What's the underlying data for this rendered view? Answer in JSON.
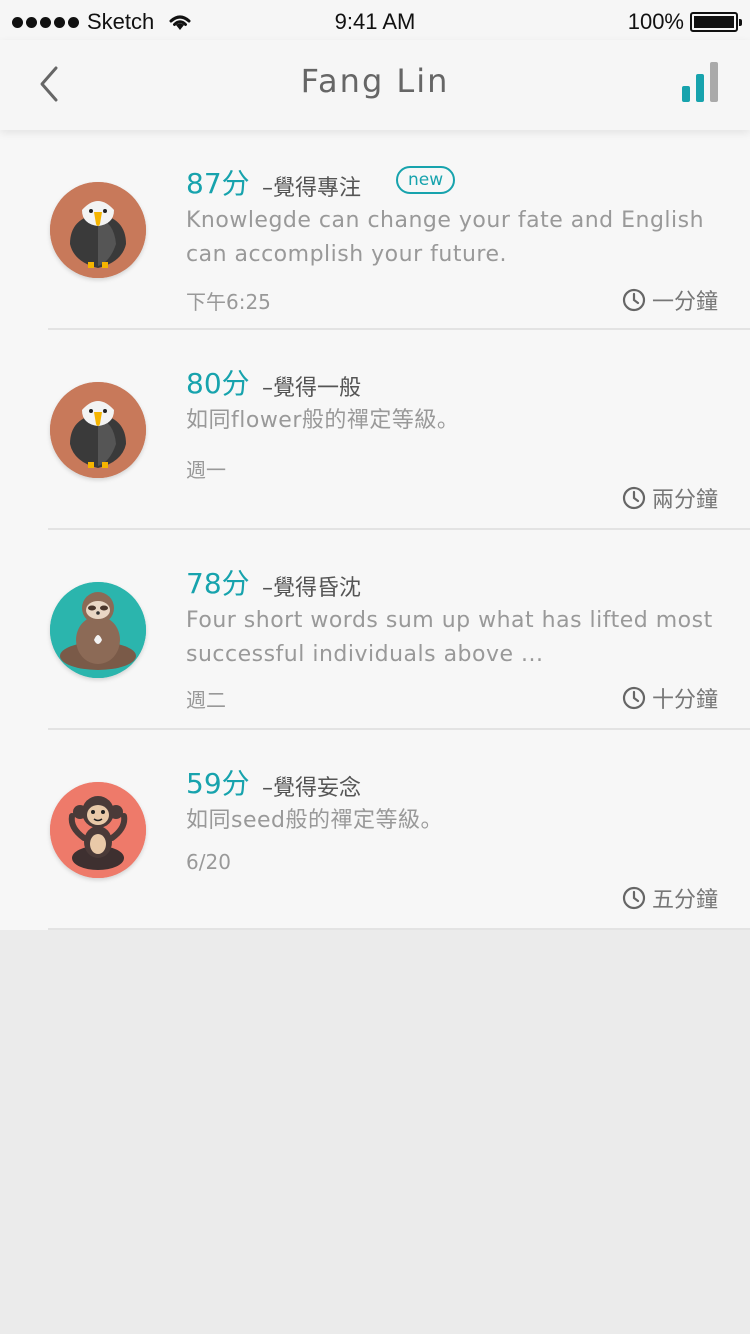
{
  "status_bar": {
    "carrier": "Sketch",
    "time": "9:41 AM",
    "battery": "100%"
  },
  "nav": {
    "title": "Fang Lin",
    "back_icon": "chevron-left-icon",
    "stats_icon": "bar-chart-icon"
  },
  "colors": {
    "accent": "#17a3ad",
    "eagle_bg": "#c8795a",
    "sloth_bg": "#2bb5ad",
    "monkey_bg": "#ee7a6a"
  },
  "entries": [
    {
      "score": "87分",
      "mood": "–覺得專注",
      "badge": "new",
      "message": "Knowlegde can change your fate and English can accomplish your future.",
      "date": "下午6:25",
      "duration": "一分鐘",
      "avatar": "eagle"
    },
    {
      "score": "80分",
      "mood": "–覺得一般",
      "message": "如同flower般的禪定等級。",
      "date": "週一",
      "duration": "兩分鐘",
      "avatar": "eagle"
    },
    {
      "score": "78分",
      "mood": "–覺得昏沈",
      "message": "Four short words sum up what has lifted most successful individuals above ...",
      "date": "週二",
      "duration": "十分鐘",
      "avatar": "sloth"
    },
    {
      "score": "59分",
      "mood": "–覺得妄念",
      "message": "如同seed般的禪定等級。",
      "date": "6/20",
      "duration": "五分鐘",
      "avatar": "monkey"
    }
  ]
}
